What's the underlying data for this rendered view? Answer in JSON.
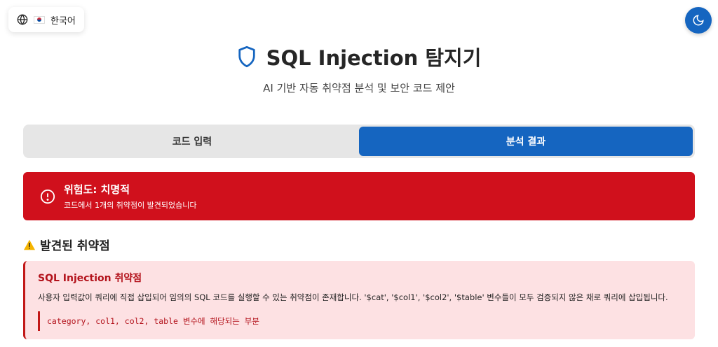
{
  "language": {
    "label": "한국어",
    "flag": "kr-flag-icon"
  },
  "theme_toggle": {
    "icon": "moon-icon"
  },
  "header": {
    "title": "SQL Injection 탐지기",
    "subtitle": "AI 기반 자동 취약점 분석 및 보안 코드 제안",
    "icon": "shield-icon"
  },
  "tabs": [
    {
      "label": "코드 입력",
      "active": false
    },
    {
      "label": "분석 결과",
      "active": true
    }
  ],
  "risk": {
    "title": "위험도: 치명적",
    "description": "코드에서 1개의 취약점이 발견되었습니다",
    "icon": "alert-circle-icon",
    "color": "#d0101c"
  },
  "findings": {
    "title": "발견된 취약점",
    "icon": "warning-icon",
    "items": [
      {
        "title": "SQL Injection 취약점",
        "description": "사용자 입력값이 쿼리에 직접 삽입되어 임의의 SQL 코드를 실행할 수 있는 취약점이 존재합니다. '$cat', '$col1', '$col2', '$table' 변수들이 모두 검증되지 않은 채로 쿼리에 삽입됩니다.",
        "code": "category, col1, col2, table 변수에 해당되는 부분"
      }
    ]
  },
  "colors": {
    "primary": "#1565c0",
    "danger": "#d0101c",
    "danger_bg": "#fde1e3"
  }
}
